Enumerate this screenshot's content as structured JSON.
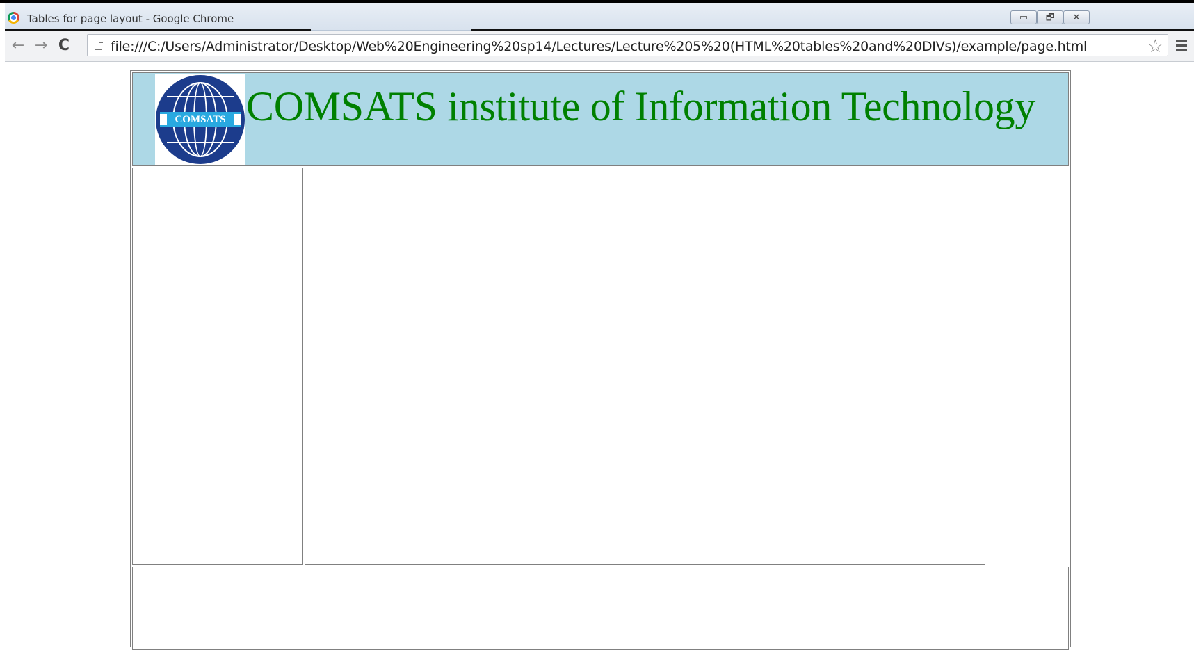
{
  "window": {
    "title": "Tables for page layout - Google Chrome",
    "buttons": {
      "minimize": "▭",
      "restore": "🗗",
      "close": "✕"
    }
  },
  "toolbar": {
    "back_icon": "←",
    "forward_icon": "→",
    "reload_icon": "C",
    "url": "file:///C:/Users/Administrator/Desktop/Web%20Engineering%20sp14/Lectures/Lecture%205%20(HTML%20tables%20and%20DIVs)/example/page.html",
    "star_icon": "☆"
  },
  "page": {
    "site_title": "COMSATS institute of Information Technology",
    "logo_text": "COMSATS",
    "colors": {
      "header_bg": "#add8e6",
      "title_color": "#008000",
      "logo_blue": "#1c3c8c"
    }
  }
}
